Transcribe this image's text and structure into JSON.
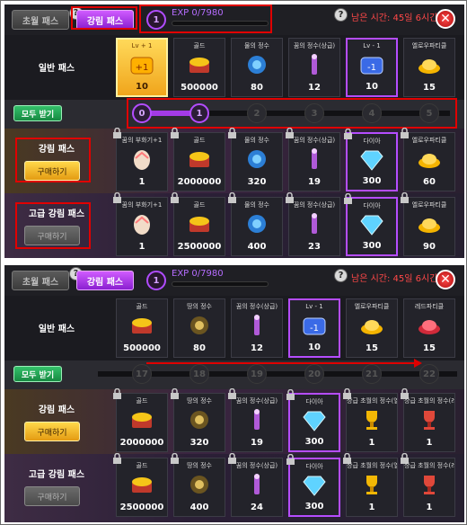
{
  "colors": {
    "accent": "#b34dff",
    "annotation": "#e00000",
    "confirm": "#1f9e4e",
    "buy": "#f0b428"
  },
  "panel1": {
    "tabs": {
      "basic": "초월 패스",
      "strong": "강림 패스"
    },
    "level": "1",
    "exp": "EXP 0/7980",
    "remain": "남은 시간: 45일 6시간",
    "general_label": "일반 패스",
    "strong_label": "강림 패스",
    "high_label": "고급 강림 패스",
    "buy_label": "구매하기",
    "all_receive": "모두 받기",
    "levels": [
      "0",
      "1",
      "2",
      "3",
      "4",
      "5"
    ],
    "general": [
      {
        "name": "Lv + 1",
        "value": "10",
        "icon": "level-up-icon"
      },
      {
        "name": "골드",
        "value": "500000",
        "icon": "gold-icon"
      },
      {
        "name": "물의 정수",
        "value": "80",
        "icon": "water-essence-icon"
      },
      {
        "name": "꿈의 정수(상급)",
        "value": "12",
        "icon": "dream-essence-icon"
      },
      {
        "name": "Lv - 1",
        "value": "10",
        "icon": "level-down-icon"
      },
      {
        "name": "엘로우파티클",
        "value": "15",
        "icon": "yellow-particle-icon"
      }
    ],
    "strong": [
      {
        "name": "꿈의 부화기+1",
        "value": "1",
        "icon": "incubator-icon"
      },
      {
        "name": "골드",
        "value": "2000000",
        "icon": "gold-icon"
      },
      {
        "name": "물의 정수",
        "value": "320",
        "icon": "water-essence-icon"
      },
      {
        "name": "꿈의 정수(상급)",
        "value": "19",
        "icon": "dream-essence-icon"
      },
      {
        "name": "다이아",
        "value": "300",
        "icon": "diamond-icon"
      },
      {
        "name": "엘로우파티클",
        "value": "60",
        "icon": "yellow-particle-icon"
      }
    ],
    "high": [
      {
        "name": "꿈의 부화기+1",
        "value": "1",
        "icon": "incubator-icon"
      },
      {
        "name": "골드",
        "value": "2500000",
        "icon": "gold-icon"
      },
      {
        "name": "물의 정수",
        "value": "400",
        "icon": "water-essence-icon"
      },
      {
        "name": "꿈의 정수(상급)",
        "value": "23",
        "icon": "dream-essence-icon"
      },
      {
        "name": "다이아",
        "value": "300",
        "icon": "diamond-icon"
      },
      {
        "name": "엘로우파티클",
        "value": "90",
        "icon": "yellow-particle-icon"
      }
    ]
  },
  "panel2": {
    "tabs": {
      "basic": "초월 패스",
      "strong": "강림 패스"
    },
    "level": "1",
    "exp": "EXP 0/7980",
    "remain": "남은 시간: 45일 6시간",
    "general_label": "일반 패스",
    "strong_label": "강림 패스",
    "high_label": "고급 강림 패스",
    "buy_label": "구매하기",
    "all_receive": "모두 받기",
    "levels": [
      "17",
      "18",
      "19",
      "20",
      "21",
      "22"
    ],
    "general": [
      {
        "name": "골드",
        "value": "500000",
        "icon": "gold-icon"
      },
      {
        "name": "땅의 정수",
        "value": "80",
        "icon": "earth-essence-icon"
      },
      {
        "name": "꿈의 정수(상급)",
        "value": "12",
        "icon": "dream-essence-icon"
      },
      {
        "name": "Lv - 1",
        "value": "10",
        "icon": "level-down-icon"
      },
      {
        "name": "엘로우파티클",
        "value": "15",
        "icon": "yellow-particle-icon"
      },
      {
        "name": "레드파티클",
        "value": "15",
        "icon": "red-particle-icon"
      }
    ],
    "strong": [
      {
        "name": "골드",
        "value": "2000000",
        "icon": "gold-icon"
      },
      {
        "name": "땅의 정수",
        "value": "320",
        "icon": "earth-essence-icon"
      },
      {
        "name": "꿈의 정수(상급)",
        "value": "19",
        "icon": "dream-essence-icon"
      },
      {
        "name": "다이아",
        "value": "300",
        "icon": "diamond-icon"
      },
      {
        "name": "상급 초월의 정수(옐로)",
        "value": "1",
        "icon": "yellow-trophy-icon"
      },
      {
        "name": "상급 초월의 정수(레드)",
        "value": "1",
        "icon": "red-trophy-icon"
      }
    ],
    "high": [
      {
        "name": "골드",
        "value": "2500000",
        "icon": "gold-icon"
      },
      {
        "name": "땅의 정수",
        "value": "400",
        "icon": "earth-essence-icon"
      },
      {
        "name": "꿈의 정수(상급)",
        "value": "24",
        "icon": "dream-essence-icon"
      },
      {
        "name": "다이아",
        "value": "300",
        "icon": "diamond-icon"
      },
      {
        "name": "상급 초월의 정수(옐로)",
        "value": "1",
        "icon": "yellow-trophy-icon"
      },
      {
        "name": "상급 초월의 정수(레드)",
        "value": "1",
        "icon": "red-trophy-icon"
      }
    ]
  }
}
